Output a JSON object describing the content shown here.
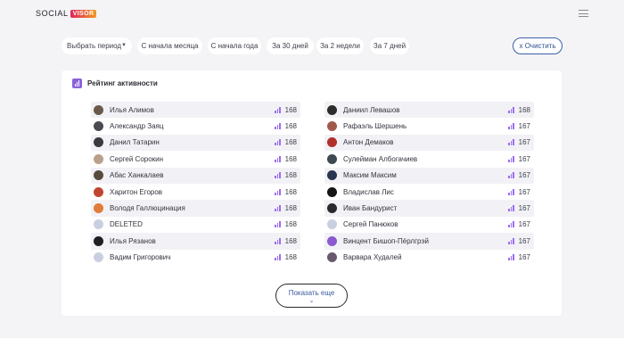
{
  "brand": {
    "part1": "SOCIAL",
    "part2": "VISOR"
  },
  "filters": {
    "period_select": "Выбрать период",
    "chips": [
      "С начала месяца",
      "С начала года",
      "За 30 дней",
      "За 2 недели",
      "За 7 дней"
    ],
    "clear": "x Очистить"
  },
  "card": {
    "title": "Рейтинг активности"
  },
  "left_list": [
    {
      "name": "Илья Алимов",
      "score": "168",
      "avatar": "#6b5a4a"
    },
    {
      "name": "Александр Заяц",
      "score": "168",
      "avatar": "#4a4a52"
    },
    {
      "name": "Данил Татарин",
      "score": "168",
      "avatar": "#3b3b3f"
    },
    {
      "name": "Сергей Сорокин",
      "score": "168",
      "avatar": "#b8a08a"
    },
    {
      "name": "Абас Ханкалаев",
      "score": "168",
      "avatar": "#5a4a3e"
    },
    {
      "name": "Харитон Егоров",
      "score": "168",
      "avatar": "#c0452f"
    },
    {
      "name": "Володя Галлюцинация",
      "score": "168",
      "avatar": "#e07b39"
    },
    {
      "name": "DELETED",
      "score": "168",
      "avatar": "#c9cfe0"
    },
    {
      "name": "Илья Рязанов",
      "score": "168",
      "avatar": "#1f1f22"
    },
    {
      "name": "Вадим Григорович",
      "score": "168",
      "avatar": "#c9cfe0"
    }
  ],
  "right_list": [
    {
      "name": "Даниил Левашов",
      "score": "168",
      "avatar": "#2c2c2c"
    },
    {
      "name": "Рафаэль Шершень",
      "score": "167",
      "avatar": "#a05a4a"
    },
    {
      "name": "Антон Демаков",
      "score": "167",
      "avatar": "#b0302a"
    },
    {
      "name": "Сулейман Албогачиев",
      "score": "167",
      "avatar": "#3e4a52"
    },
    {
      "name": "Максим Максим",
      "score": "167",
      "avatar": "#2a3550"
    },
    {
      "name": "Владислав Лис",
      "score": "167",
      "avatar": "#151515"
    },
    {
      "name": "Иван Бандурист",
      "score": "167",
      "avatar": "#2a2a2e"
    },
    {
      "name": "Сергей Панюков",
      "score": "167",
      "avatar": "#c9cfe0"
    },
    {
      "name": "Винцент Бишоп-Пёрлгрэй",
      "score": "167",
      "avatar": "#8a5ad0"
    },
    {
      "name": "Варвара Худалей",
      "score": "167",
      "avatar": "#6a5a6e"
    }
  ],
  "show_more": {
    "label": "Показать еще",
    "chevron": "⌄"
  },
  "colors": {
    "accent": "#8b62d9",
    "bar": "#9b6cf0",
    "clear_border": "#3a60a8"
  }
}
